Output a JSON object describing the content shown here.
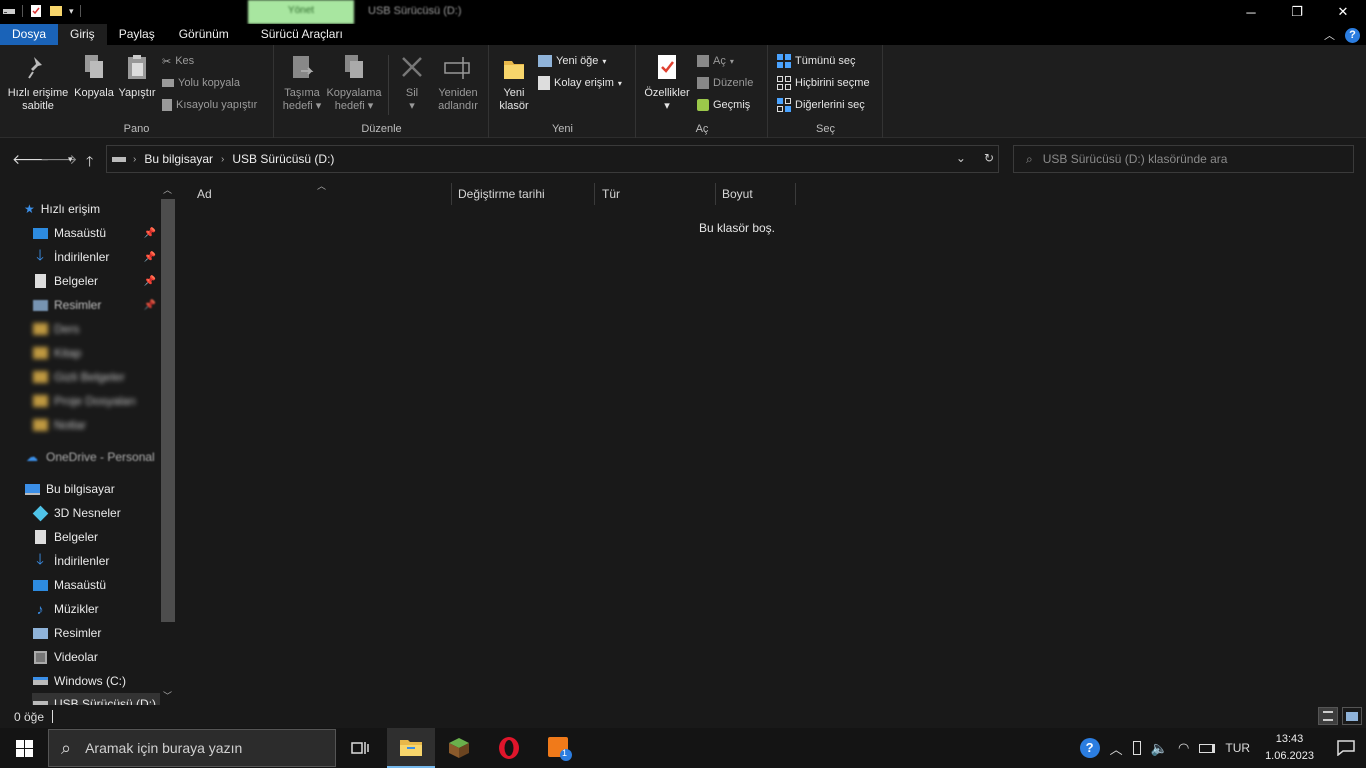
{
  "window": {
    "context_tab": "Yönet",
    "title": "USB Sürücüsü (D:)"
  },
  "ribbon_tabs": [
    "Dosya",
    "Giriş",
    "Paylaş",
    "Görünüm",
    "Sürücü Araçları"
  ],
  "ribbon": {
    "pano": {
      "label": "Pano",
      "pin_l1": "Hızlı erişime",
      "pin_l2": "sabitle",
      "copy": "Kopyala",
      "paste": "Yapıştır",
      "cut": "Kes",
      "copy_path": "Yolu kopyala",
      "paste_shortcut": "Kısayolu yapıştır"
    },
    "duzenle": {
      "label": "Düzenle",
      "move_l1": "Taşıma",
      "move_l2": "hedefi",
      "copyto_l1": "Kopyalama",
      "copyto_l2": "hedefi",
      "delete": "Sil",
      "rename_l1": "Yeniden",
      "rename_l2": "adlandır"
    },
    "yeni": {
      "label": "Yeni",
      "folder_l1": "Yeni",
      "folder_l2": "klasör",
      "new_item": "Yeni öğe",
      "easy_access": "Kolay erişim"
    },
    "ac": {
      "label": "Aç",
      "properties": "Özellikler",
      "open": "Aç",
      "edit": "Düzenle",
      "history": "Geçmiş"
    },
    "sec": {
      "label": "Seç",
      "select_all": "Tümünü seç",
      "select_none": "Hiçbirini seçme",
      "invert": "Diğerlerini seç"
    }
  },
  "address": {
    "crumbs": [
      "Bu bilgisayar",
      "USB Sürücüsü (D:)"
    ],
    "search_placeholder": "USB Sürücüsü (D:) klasöründe ara"
  },
  "nav": {
    "quick_access": "Hızlı erişim",
    "quick": [
      "Masaüstü",
      "İndirilenler",
      "Belgeler",
      "Resimler"
    ],
    "blurred": [
      "Ders",
      "Kitap",
      "Gizli Belgeler",
      "Proje Dosyaları",
      "Notlar"
    ],
    "onedrive": "OneDrive - Personal",
    "this_pc": "Bu bilgisayar",
    "pc": [
      "3D Nesneler",
      "Belgeler",
      "İndirilenler",
      "Masaüstü",
      "Müzikler",
      "Resimler",
      "Videolar",
      "Windows (C:)",
      "USB Sürücüsü (D:)"
    ]
  },
  "columns": [
    "Ad",
    "Değiştirme tarihi",
    "Tür",
    "Boyut"
  ],
  "empty_message": "Bu klasör boş.",
  "status": {
    "count": "0 öğe"
  },
  "taskbar": {
    "search_placeholder": "Aramak için buraya yazın",
    "lang": "TUR",
    "time": "13:43",
    "date": "1.06.2023",
    "badge": "1"
  },
  "colors": {
    "file_tab": "#1a63b8",
    "accent": "#76b9ed",
    "background": "#191919"
  }
}
